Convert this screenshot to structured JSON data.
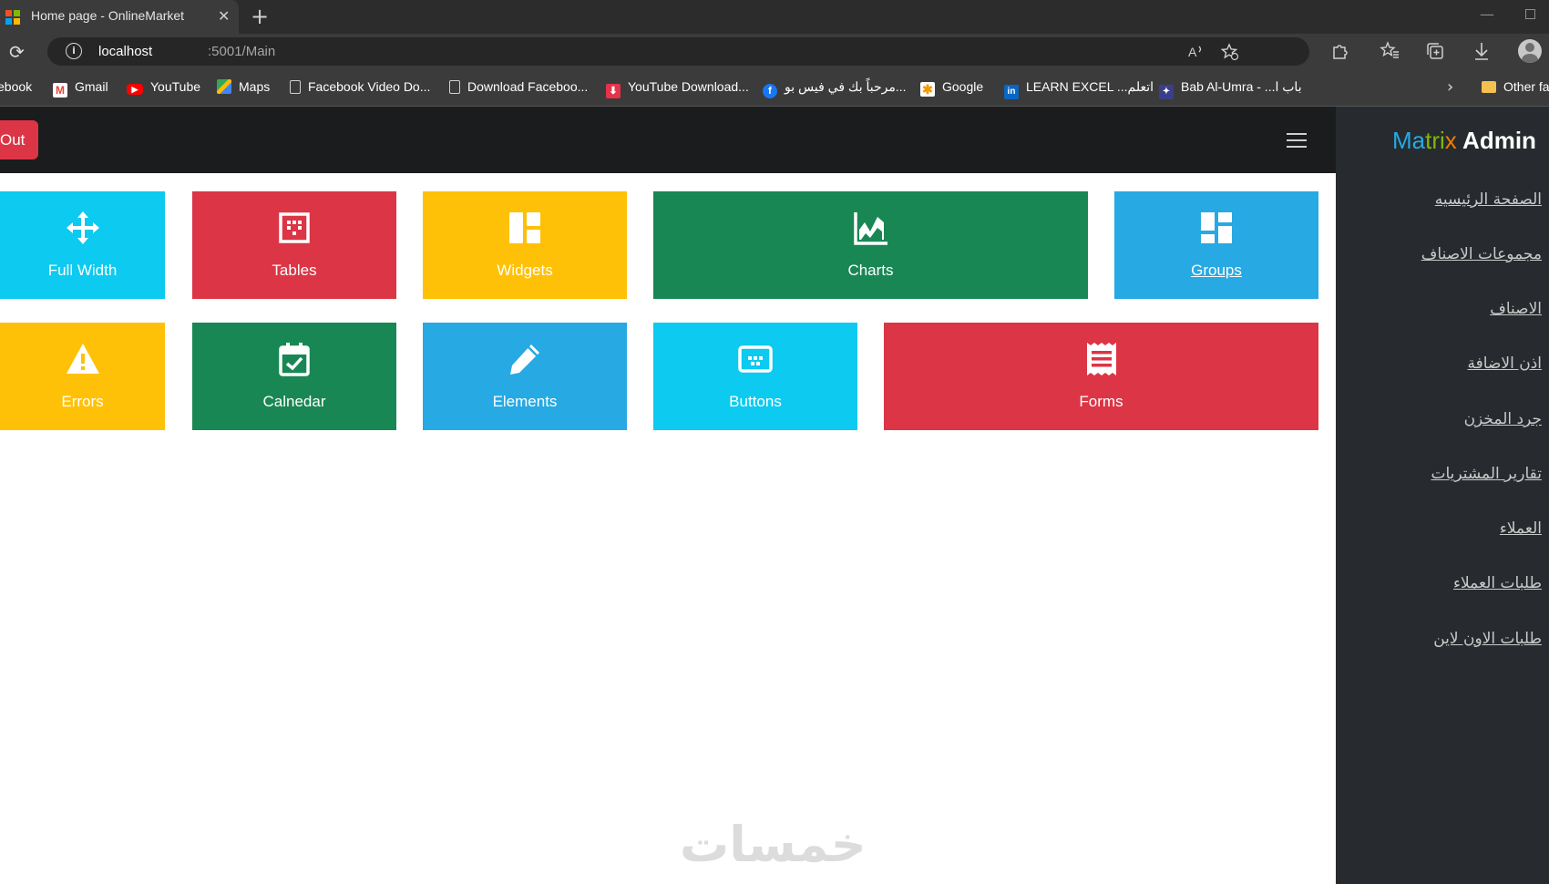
{
  "browser": {
    "tab_title": "Home page - OnlineMarket",
    "tab_close": "✕",
    "new_tab": "+",
    "window_minimize": "—",
    "reload": "⟳",
    "url_host": "localhost",
    "url_path": ":5001/Main",
    "info": "i",
    "bookmarks": [
      {
        "label": "ebook",
        "icon": "facebook-icon"
      },
      {
        "label": "Gmail",
        "icon": "gmail-icon"
      },
      {
        "label": "YouTube",
        "icon": "youtube-icon"
      },
      {
        "label": "Maps",
        "icon": "maps-icon"
      },
      {
        "label": "Facebook Video Do...",
        "icon": "page-icon"
      },
      {
        "label": "Download Faceboo...",
        "icon": "page-icon"
      },
      {
        "label": "YouTube Download...",
        "icon": "download-icon"
      },
      {
        "label": "مرحباً بك في فيس بو...",
        "icon": "facebook-icon"
      },
      {
        "label": "Google",
        "icon": "google-icon"
      },
      {
        "label": "LEARN EXCEL ...اتعلم",
        "icon": "linkedin-icon"
      },
      {
        "label": "Bab Al-Umra - ...باب ا",
        "icon": "site-icon"
      },
      {
        "label": "Other fa",
        "icon": "folder-icon"
      }
    ],
    "chevron": "›"
  },
  "topnav": {
    "logout_label": "Out"
  },
  "sidebar": {
    "brand_part1": "Ma",
    "brand_part2": "tri",
    "brand_part3": "x",
    "brand_part4": " Admin",
    "links": [
      "الصفحة الرئيسيه",
      "مجموعات الاصناف",
      "الاصناف",
      "اذن الاضافة",
      "جرد المخزن",
      "تقارير المشتريات",
      "العملاء",
      "طلبات العملاء",
      "طلبات الاون لاين"
    ]
  },
  "tiles": [
    {
      "label": "Full Width",
      "icon": "move-arrows-icon",
      "color": "#0dcaf0"
    },
    {
      "label": "Tables",
      "icon": "table-grid-icon",
      "color": "#dc3545"
    },
    {
      "label": "Widgets",
      "icon": "widgets-layout-icon",
      "color": "#ffc107"
    },
    {
      "label": "Charts",
      "icon": "area-chart-icon",
      "color": "#198754"
    },
    {
      "label": "Groups",
      "icon": "dashboard-blocks-icon",
      "color": "#27a9e3"
    },
    {
      "label": "Errors",
      "icon": "warning-triangle-icon",
      "color": "#ffc107"
    },
    {
      "label": "Calnedar",
      "icon": "calendar-check-icon",
      "color": "#198754"
    },
    {
      "label": "Elements",
      "icon": "pencil-icon",
      "color": "#27a9e3"
    },
    {
      "label": "Buttons",
      "icon": "button-dots-icon",
      "color": "#0dcaf0"
    },
    {
      "label": "Forms",
      "icon": "receipt-form-icon",
      "color": "#dc3545"
    }
  ],
  "watermark": "خمسات"
}
